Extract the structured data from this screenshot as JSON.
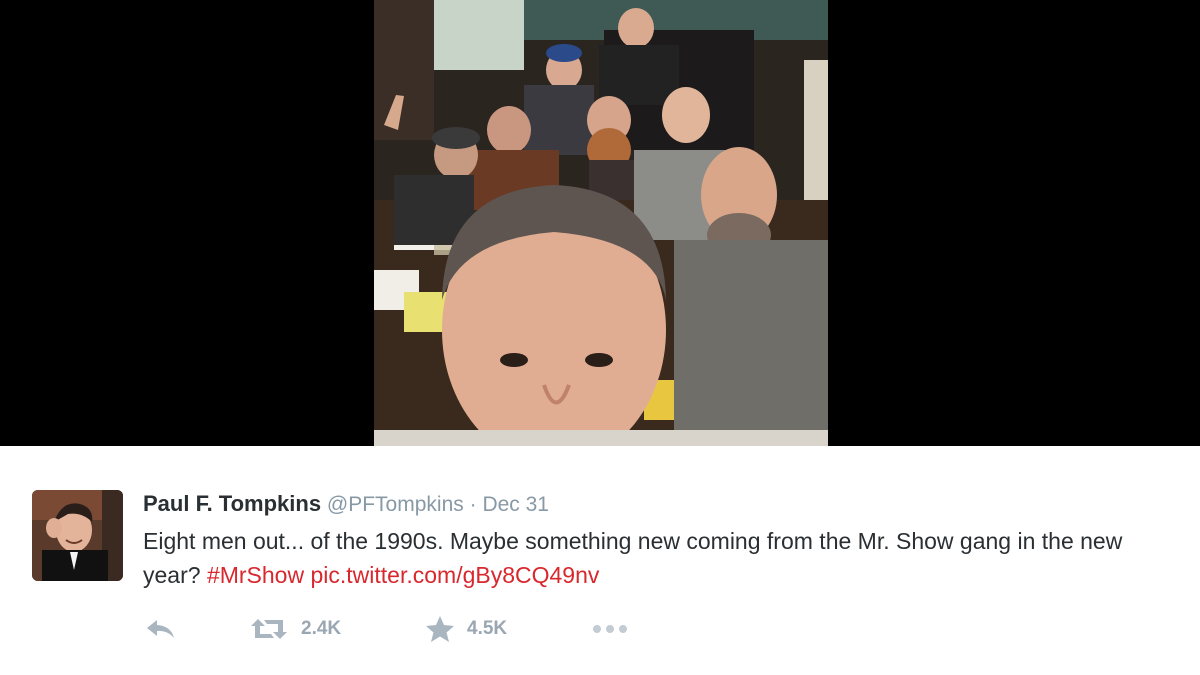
{
  "tweet": {
    "name": "Paul F. Tompkins",
    "handle": "@PFTompkins",
    "separator": "·",
    "date": "Dec 31",
    "text_line_main": "Eight men out... of the 1990s. Maybe something new coming from the Mr. Show gang in the new year? ",
    "hashtag": "#MrShow",
    "link": "pic.twitter.com/gBy8CQ49nv"
  },
  "actions": {
    "reply_icon": "reply-icon",
    "retweet_icon": "retweet-icon",
    "retweet_count": "2.4K",
    "favorite_icon": "star-icon",
    "favorite_count": "4.5K",
    "more_icon": "more-dots-icon"
  },
  "colors": {
    "link": "#d9272e",
    "muted": "#8899a6",
    "text": "#292f33",
    "action": "#a9b6c0"
  }
}
